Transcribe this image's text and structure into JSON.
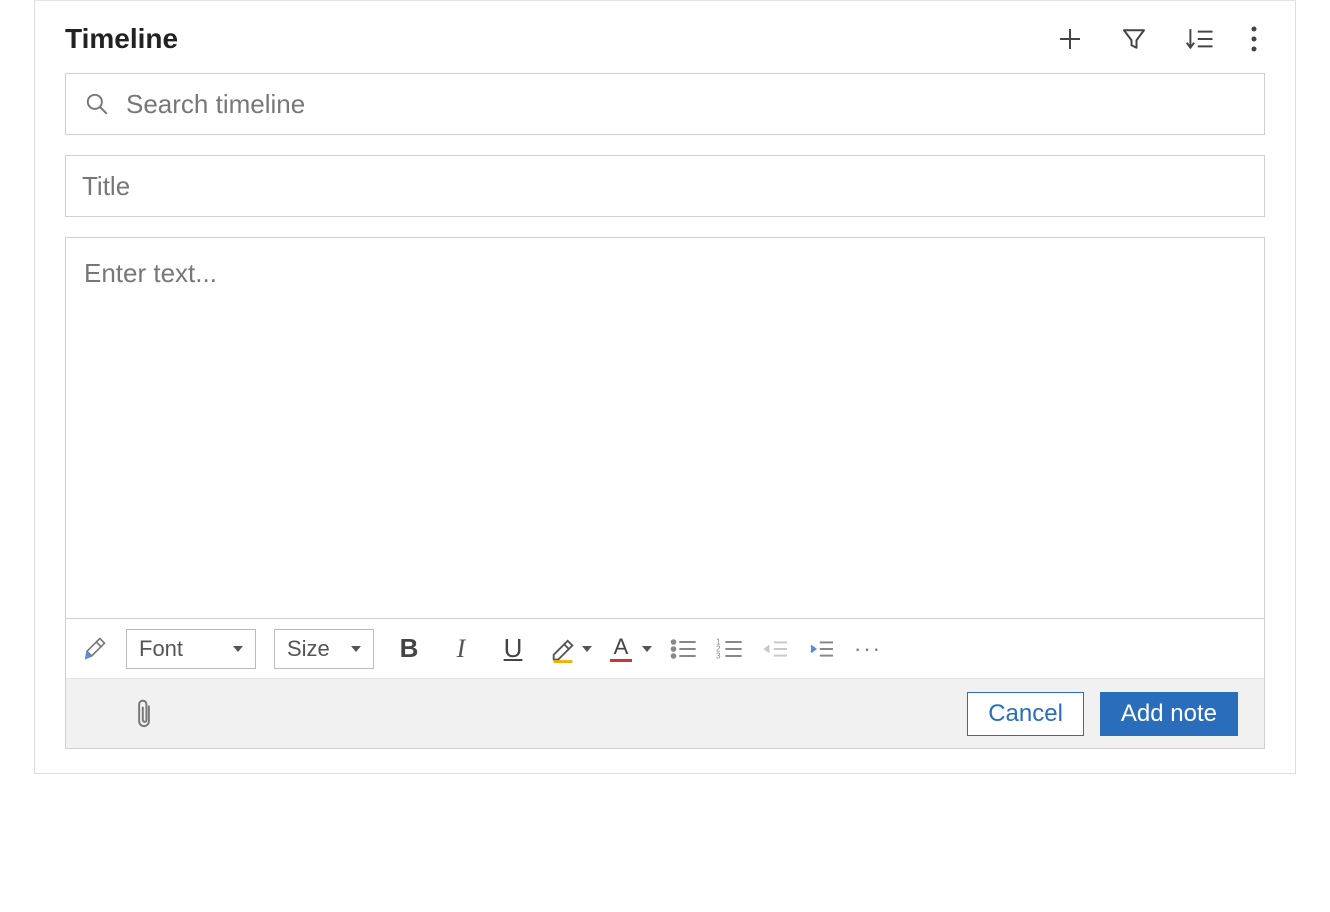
{
  "header": {
    "title": "Timeline"
  },
  "search": {
    "placeholder": "Search timeline",
    "value": ""
  },
  "note": {
    "title_placeholder": "Title",
    "title_value": "",
    "body_placeholder": "Enter text...",
    "body_value": ""
  },
  "toolbar": {
    "font_label": "Font",
    "size_label": "Size",
    "bold_glyph": "B",
    "italic_glyph": "I",
    "underline_glyph": "U",
    "font_color_glyph": "A",
    "more_glyph": "···"
  },
  "footer": {
    "cancel_label": "Cancel",
    "add_note_label": "Add note"
  },
  "colors": {
    "primary": "#2a6ebb",
    "highlight_underline": "#f0b000",
    "fontcolor_underline": "#d13438",
    "border": "#cfcfcf",
    "footer_bg": "#f1f1f1"
  }
}
